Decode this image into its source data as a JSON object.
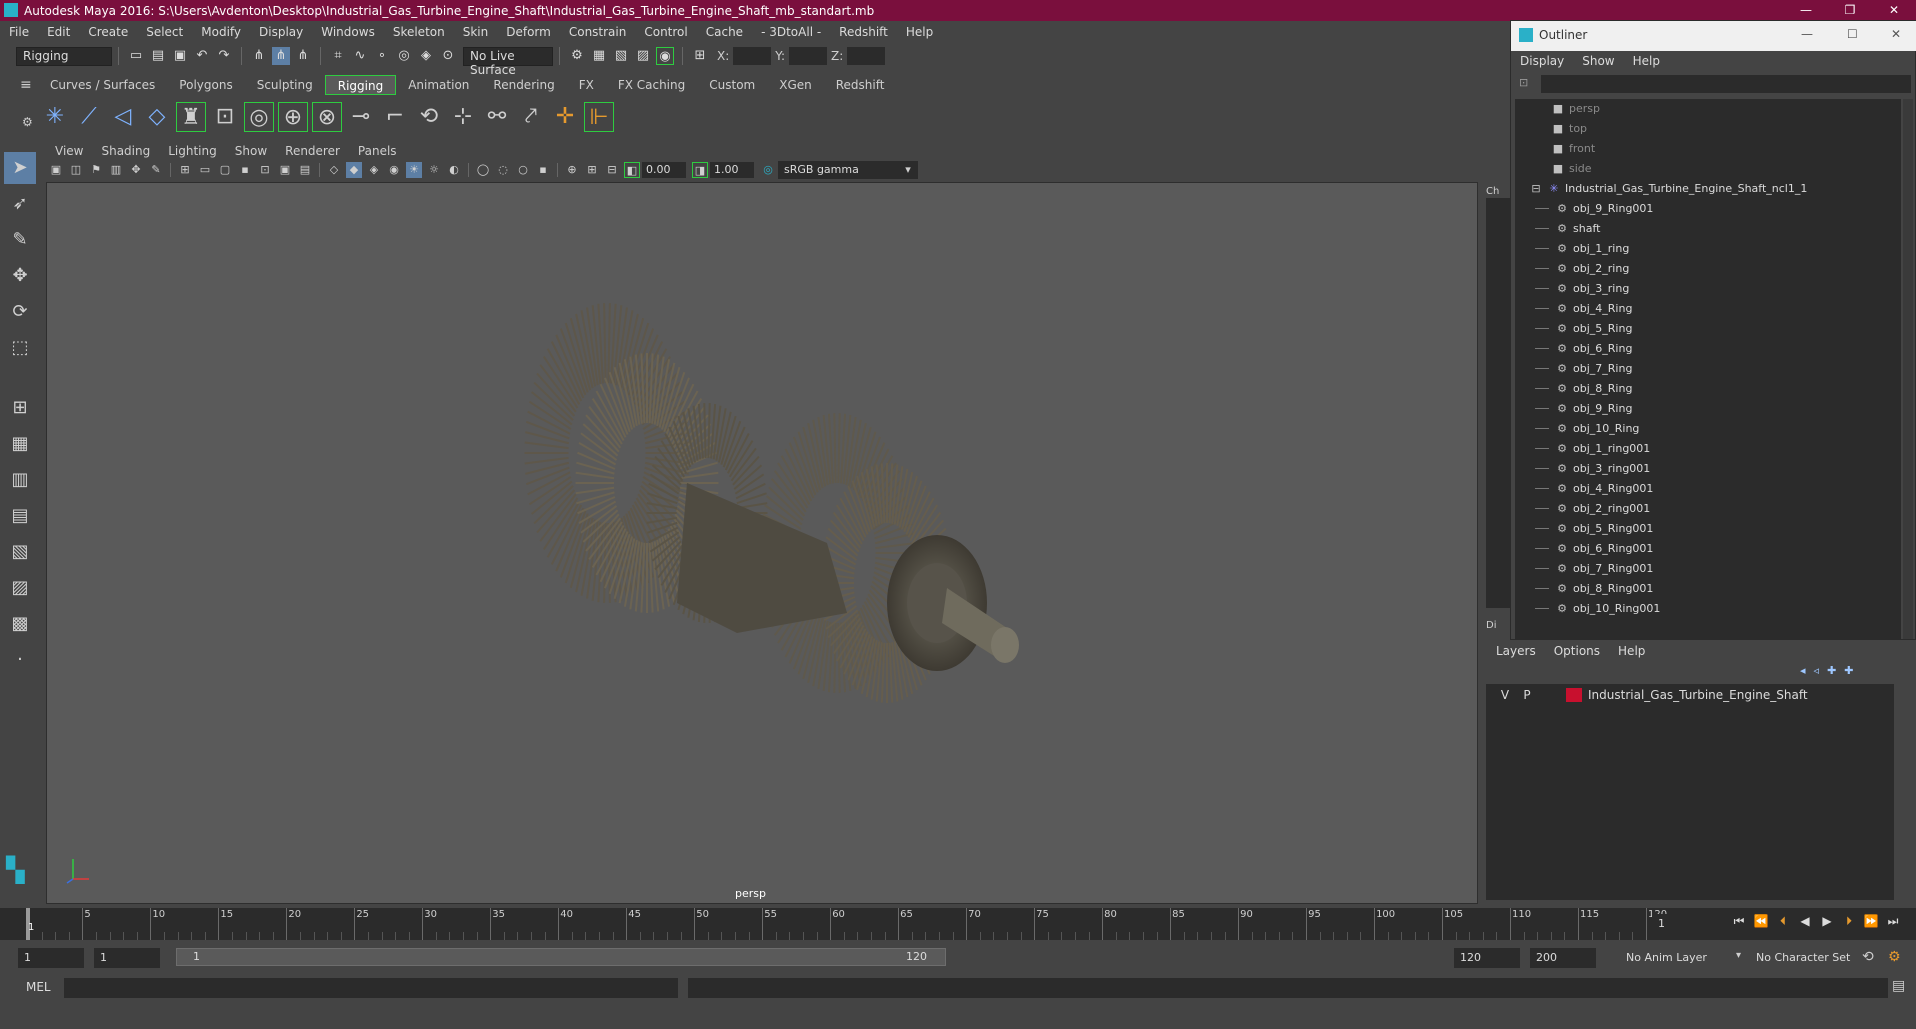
{
  "window": {
    "title": "Autodesk Maya 2016: S:\\Users\\Avdenton\\Desktop\\Industrial_Gas_Turbine_Engine_Shaft\\Industrial_Gas_Turbine_Engine_Shaft_mb_standart.mb"
  },
  "menubar": [
    "File",
    "Edit",
    "Create",
    "Select",
    "Modify",
    "Display",
    "Windows",
    "Skeleton",
    "Skin",
    "Deform",
    "Constrain",
    "Control",
    "Cache",
    "- 3DtoAll -",
    "Redshift",
    "Help"
  ],
  "statusline": {
    "menuset": "Rigging",
    "live_surface": "No Live Surface",
    "x_label": "X:",
    "y_label": "Y:",
    "z_label": "Z:"
  },
  "shelf": {
    "tabs": [
      "Curves / Surfaces",
      "Polygons",
      "Sculpting",
      "Rigging",
      "Animation",
      "Rendering",
      "FX",
      "FX Caching",
      "Custom",
      "XGen",
      "Redshift"
    ],
    "active_tab": "Rigging"
  },
  "viewport": {
    "menu": [
      "View",
      "Shading",
      "Lighting",
      "Show",
      "Renderer",
      "Panels"
    ],
    "exposure": "0.00",
    "gamma_value": "1.00",
    "color_space": "sRGB gamma",
    "camera_label": "persp"
  },
  "outliner": {
    "title": "Outliner",
    "menu": [
      "Display",
      "Show",
      "Help"
    ],
    "cameras": [
      "persp",
      "top",
      "front",
      "side"
    ],
    "group": "Industrial_Gas_Turbine_Engine_Shaft_ncl1_1",
    "children": [
      "obj_9_Ring001",
      "shaft",
      "obj_1_ring",
      "obj_2_ring",
      "obj_3_ring",
      "obj_4_Ring",
      "obj_5_Ring",
      "obj_6_Ring",
      "obj_7_Ring",
      "obj_8_Ring",
      "obj_9_Ring",
      "obj_10_Ring",
      "obj_1_ring001",
      "obj_3_ring001",
      "obj_4_Ring001",
      "obj_2_ring001",
      "obj_5_Ring001",
      "obj_6_Ring001",
      "obj_7_Ring001",
      "obj_8_Ring001",
      "obj_10_Ring001"
    ]
  },
  "side_tabs": {
    "channel": "Ch",
    "display": "Di"
  },
  "layers": {
    "menu": [
      "Layers",
      "Options",
      "Help"
    ],
    "rows": [
      {
        "v": "V",
        "p": "P",
        "name": "Industrial_Gas_Turbine_Engine_Shaft",
        "color": "#c8102e"
      }
    ]
  },
  "timeline": {
    "ticks": [
      "5",
      "10",
      "15",
      "20",
      "25",
      "30",
      "35",
      "40",
      "45",
      "50",
      "55",
      "60",
      "65",
      "70",
      "75",
      "80",
      "85",
      "90",
      "95",
      "100",
      "105",
      "110",
      "115",
      "120"
    ],
    "start_marker": "1",
    "current_frame": "1"
  },
  "range": {
    "start": "1",
    "start_inner": "1",
    "slider_start": "1",
    "slider_end": "120",
    "end_inner": "120",
    "end": "200",
    "anim_layer": "No Anim Layer",
    "char_set": "No Character Set"
  },
  "cmdline": {
    "lang": "MEL"
  },
  "colors": {
    "titlebar": "#7a0f3d",
    "accent_green": "#2ecc40",
    "layer_red": "#c8102e"
  }
}
